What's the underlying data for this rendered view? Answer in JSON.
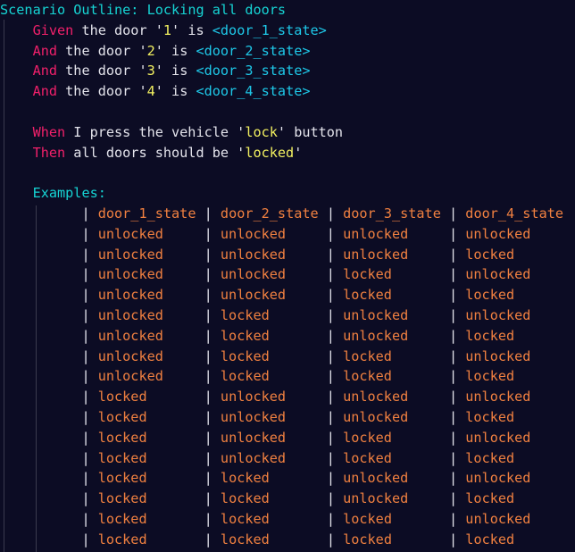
{
  "scenario": {
    "keyword": "Scenario Outline:",
    "title": "Locking all doors"
  },
  "given_steps": [
    {
      "keyword": "Given",
      "pre": "the door '",
      "door": "1",
      "mid": "' is ",
      "param": "<door_1_state>"
    },
    {
      "keyword": "And",
      "pre": "the door '",
      "door": "2",
      "mid": "' is ",
      "param": "<door_2_state>"
    },
    {
      "keyword": "And",
      "pre": "the door '",
      "door": "3",
      "mid": "' is ",
      "param": "<door_3_state>"
    },
    {
      "keyword": "And",
      "pre": "the door '",
      "door": "4",
      "mid": "' is ",
      "param": "<door_4_state>"
    }
  ],
  "when_step": {
    "keyword": "When",
    "pre": "I press the vehicle '",
    "value": "lock",
    "post": "' button"
  },
  "then_step": {
    "keyword": "Then",
    "pre": "all doors should be '",
    "value": "locked",
    "post": "'"
  },
  "examples": {
    "keyword": "Examples:",
    "header": [
      "door_1_state",
      "door_2_state",
      "door_3_state",
      "door_4_state"
    ],
    "rows": [
      [
        "unlocked",
        "unlocked",
        "unlocked",
        "unlocked"
      ],
      [
        "unlocked",
        "unlocked",
        "unlocked",
        "locked"
      ],
      [
        "unlocked",
        "unlocked",
        "locked",
        "unlocked"
      ],
      [
        "unlocked",
        "unlocked",
        "locked",
        "locked"
      ],
      [
        "unlocked",
        "locked",
        "unlocked",
        "unlocked"
      ],
      [
        "unlocked",
        "locked",
        "unlocked",
        "locked"
      ],
      [
        "unlocked",
        "locked",
        "locked",
        "unlocked"
      ],
      [
        "unlocked",
        "locked",
        "locked",
        "locked"
      ],
      [
        "locked",
        "unlocked",
        "unlocked",
        "unlocked"
      ],
      [
        "locked",
        "unlocked",
        "unlocked",
        "locked"
      ],
      [
        "locked",
        "unlocked",
        "locked",
        "unlocked"
      ],
      [
        "locked",
        "unlocked",
        "locked",
        "locked"
      ],
      [
        "locked",
        "locked",
        "unlocked",
        "unlocked"
      ],
      [
        "locked",
        "locked",
        "unlocked",
        "locked"
      ],
      [
        "locked",
        "locked",
        "locked",
        "unlocked"
      ],
      [
        "locked",
        "locked",
        "locked",
        "locked"
      ]
    ]
  },
  "colors": {
    "background": "#0c0c24",
    "title_keyword": "#16d4d4",
    "step_keyword": "#f0206a",
    "string_literal": "#f2f060",
    "parameter": "#1ec8e8",
    "table_cell": "#f08040",
    "text": "#e4e4ec"
  }
}
